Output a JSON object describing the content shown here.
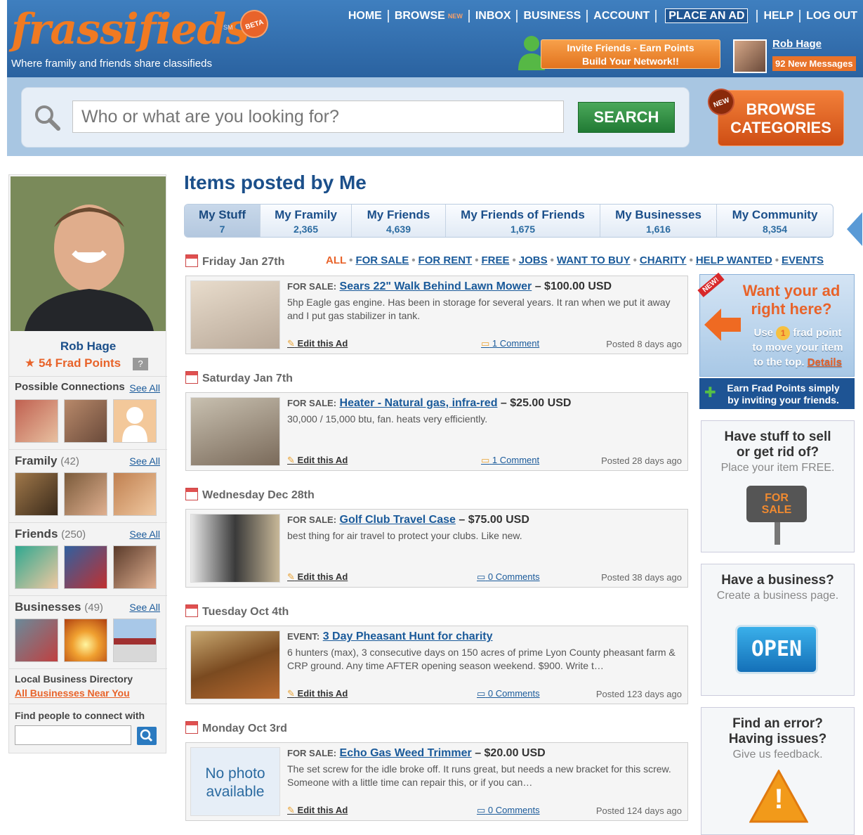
{
  "header": {
    "logo": "frassifieds",
    "logo_sm": "SM",
    "beta": "BETA",
    "tagline": "Where framily and friends share classifieds",
    "nav": [
      "HOME",
      "BROWSE",
      "INBOX",
      "BUSINESS",
      "ACCOUNT",
      "PLACE AN AD",
      "HELP",
      "LOG OUT"
    ],
    "nav_new": "NEW",
    "invite_line1": "Invite Friends - Earn Points",
    "invite_line2": "Build Your Network!!",
    "user_name": "Rob Hage",
    "messages": "92 New Messages"
  },
  "search": {
    "placeholder": "Who or what are you looking for?",
    "button": "SEARCH",
    "browse_line1": "BROWSE",
    "browse_line2": "CATEGORIES",
    "browse_new": "NEW"
  },
  "profile": {
    "name": "Rob Hage",
    "points": "54 Frad Points",
    "help": "?"
  },
  "sidebar": {
    "connections_title": "Possible Connections",
    "see_all": "See All",
    "framily_title": "Framily",
    "framily_count": "(42)",
    "friends_title": "Friends",
    "friends_count": "(250)",
    "businesses_title": "Businesses",
    "businesses_count": "(49)",
    "local_title": "Local Business Directory",
    "local_link": "All Businesses Near You",
    "find_title": "Find people to connect with"
  },
  "main": {
    "title": "Items posted by Me",
    "tabs": [
      {
        "label": "My Stuff",
        "count": "7"
      },
      {
        "label": "My Framily",
        "count": "2,365"
      },
      {
        "label": "My Friends",
        "count": "4,639"
      },
      {
        "label": "My Friends of Friends",
        "count": "1,675"
      },
      {
        "label": "My Businesses",
        "count": "1,616"
      },
      {
        "label": "My Community",
        "count": "8,354"
      }
    ],
    "filters": [
      "ALL",
      "FOR SALE",
      "FOR RENT",
      "FREE",
      "JOBS",
      "WANT TO BUY",
      "CHARITY",
      "HELP WANTED",
      "EVENTS"
    ],
    "edit_label": "Edit this Ad",
    "items": [
      {
        "date": "Friday Jan 27th",
        "cat": "FOR SALE:",
        "title": "Sears 22\" Walk Behind Lawn Mower",
        "price": "– $100.00 USD",
        "desc": "5hp Eagle gas engine. Has been in storage for several years. It ran when we put it away and I put gas stabilizer in tank.",
        "comments": "1 Comment",
        "posted": "Posted 8 days ago"
      },
      {
        "date": "Saturday Jan 7th",
        "cat": "FOR SALE:",
        "title": "Heater - Natural gas, infra-red",
        "price": "– $25.00 USD",
        "desc": "30,000 / 15,000 btu, fan. heats very efficiently.",
        "comments": "1 Comment",
        "posted": "Posted 28 days ago"
      },
      {
        "date": "Wednesday Dec 28th",
        "cat": "FOR SALE:",
        "title": "Golf Club Travel Case",
        "price": "– $75.00 USD",
        "desc": "best thing for air travel to protect your clubs. Like new.",
        "comments": "0 Comments",
        "posted": "Posted 38 days ago"
      },
      {
        "date": "Tuesday Oct 4th",
        "cat": "EVENT:",
        "title": "3 Day Pheasant Hunt for charity",
        "price": "",
        "desc": "6 hunters (max), 3 consecutive days on 150 acres of prime Lyon County pheasant farm & CRP ground. Any time AFTER opening season weekend. $900. Write t…",
        "comments": "0 Comments",
        "posted": "Posted 123 days ago"
      },
      {
        "date": "Monday Oct 3rd",
        "cat": "FOR SALE:",
        "title": "Echo Gas Weed Trimmer",
        "price": "– $20.00 USD",
        "desc": "The set screw for the idle broke off. It runs great, but needs a new bracket for this screw. Someone with a little time can repair this, or if you can…",
        "comments": "0 Comments",
        "posted": "Posted 124 days ago"
      }
    ],
    "no_photo_1": "No photo",
    "no_photo_2": "available"
  },
  "promo": {
    "new": "NEW!",
    "ad_title_1": "Want your ad",
    "ad_title_2": "right here?",
    "ad_use": "Use",
    "ad_one": "1",
    "ad_frad": "frad point",
    "ad_move": "to move your item",
    "ad_top": "to the top.",
    "ad_details": "Details",
    "earn_1": "Earn Frad Points simply",
    "earn_2": "by inviting your friends.",
    "sell_1": "Have stuff to sell",
    "sell_2": "or get rid of?",
    "sell_3": "Place your item FREE.",
    "sell_sign_1": "FOR",
    "sell_sign_2": "SALE",
    "biz_1": "Have a business?",
    "biz_2": "Create a business page.",
    "biz_sign": "OPEN",
    "err_1": "Find an error?",
    "err_2": "Having issues?",
    "err_3": "Give us feedback.",
    "err_icon": "!"
  }
}
